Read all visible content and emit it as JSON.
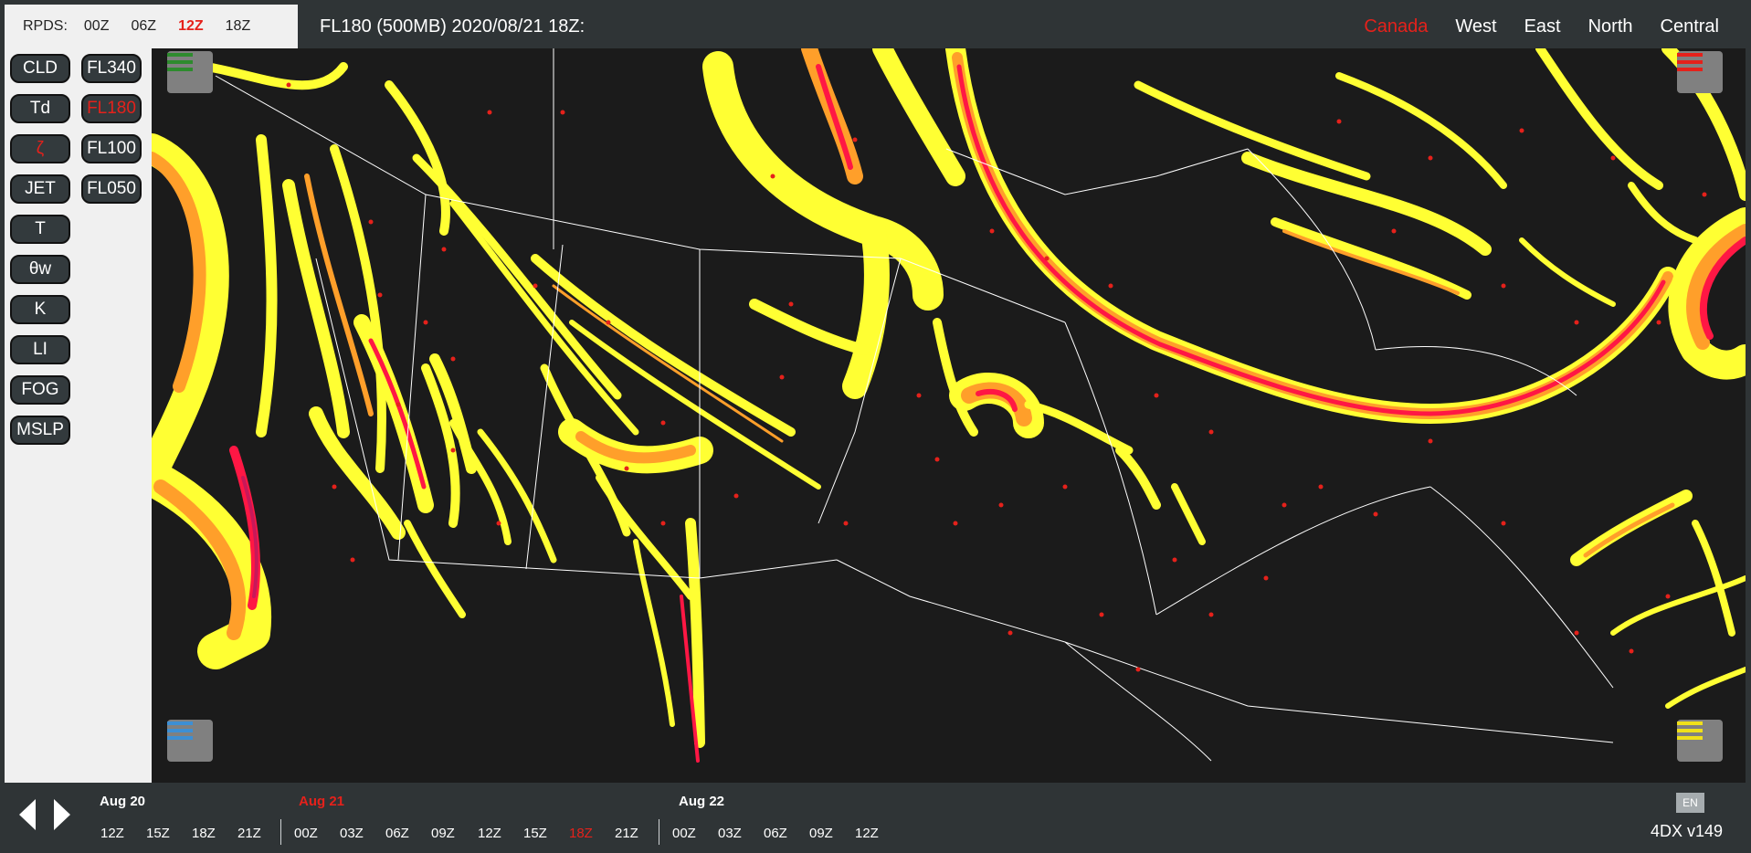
{
  "runs": {
    "label": "RPDS:",
    "items": [
      "00Z",
      "06Z",
      "12Z",
      "18Z"
    ],
    "active": "12Z"
  },
  "header": {
    "title": "FL180 (500MB) 2020/08/21 18Z:"
  },
  "regions": {
    "items": [
      "Canada",
      "West",
      "East",
      "North",
      "Central"
    ],
    "active": "Canada"
  },
  "products": {
    "col1": [
      "CLD",
      "Td",
      "ζ",
      "JET",
      "T",
      "θw",
      "K",
      "LI",
      "FOG",
      "MSLP"
    ],
    "col2": [
      "FL340",
      "FL180",
      "FL100",
      "FL050"
    ],
    "active": [
      "ζ",
      "FL180"
    ]
  },
  "map": {
    "menu_buttons": [
      {
        "name": "top-left",
        "color": "#2e8b2e"
      },
      {
        "name": "top-right",
        "color": "#e5211b"
      },
      {
        "name": "bottom-left",
        "color": "#3d8fd4"
      },
      {
        "name": "bottom-right",
        "color": "#f0e01a"
      }
    ],
    "colors": {
      "background": "#1b1b1b",
      "light": "#ffff33",
      "moderate": "#ff9f2a",
      "severe": "#ff1744",
      "extreme": "#c81859",
      "stations": "#e5211b",
      "boundaries": "#ffffff"
    }
  },
  "timeline": {
    "days": [
      {
        "label": "Aug 20",
        "hours": [
          "12Z",
          "15Z",
          "18Z",
          "21Z"
        ]
      },
      {
        "label": "Aug 21",
        "hours": [
          "00Z",
          "03Z",
          "06Z",
          "09Z",
          "12Z",
          "15Z",
          "18Z",
          "21Z"
        ]
      },
      {
        "label": "Aug 22",
        "hours": [
          "00Z",
          "03Z",
          "06Z",
          "09Z",
          "12Z"
        ]
      }
    ],
    "active_day": "Aug 21",
    "active_hour": "18Z",
    "language": "EN",
    "version": "4DX v149"
  }
}
